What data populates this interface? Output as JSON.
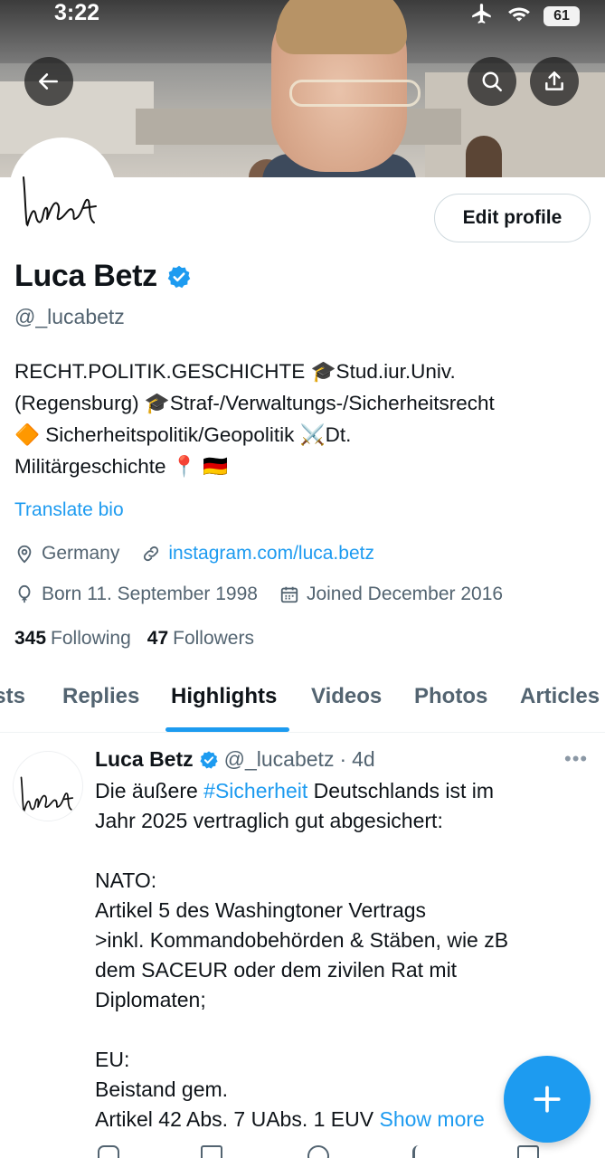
{
  "status_bar": {
    "time": "3:22",
    "battery": "61"
  },
  "profile": {
    "name": "Luca Betz",
    "handle": "@_lucabetz",
    "edit_label": "Edit profile",
    "bio_lines": [
      "RECHT.POLITIK.GESCHICHTE 🎓Stud.iur.Univ.",
      "(Regensburg) 🎓Straf-/Verwaltungs-/Sicherheitsrecht",
      "🔶 Sicherheitspolitik/Geopolitik ⚔️Dt.",
      "Militärgeschichte 📍 🇩🇪"
    ],
    "translate_label": "Translate bio",
    "location": "Germany",
    "website": "instagram.com/luca.betz",
    "born": "Born 11. September 1998",
    "joined": "Joined December 2016",
    "following_count": "345",
    "following_label": "Following",
    "followers_count": "47",
    "followers_label": "Followers"
  },
  "tabs": [
    "Posts",
    "Replies",
    "Highlights",
    "Videos",
    "Photos",
    "Articles"
  ],
  "active_tab": "Highlights",
  "tweet": {
    "name": "Luca Betz",
    "handle": "@_lucabetz",
    "separator": "·",
    "time": "4d",
    "line1_pre": "Die äußere ",
    "hashtag": "#Sicherheit",
    "line1_post": " Deutschlands ist im",
    "lines": [
      "Jahr 2025 vertraglich gut abgesichert:",
      "",
      "NATO:",
      "Artikel 5 des Washingtoner Vertrags",
      ">inkl. Kommandobehörden & Stäben, wie zB",
      "dem SACEUR oder dem zivilen Rat mit",
      "Diplomaten;",
      "",
      "EU:",
      "Beistand gem."
    ],
    "last_line": "Artikel 42 Abs. 7 UAbs. 1 EUV ",
    "show_more": "Show more"
  },
  "colors": {
    "accent": "#1d9bf0",
    "text": "#0f1419",
    "secondary": "#536471"
  }
}
